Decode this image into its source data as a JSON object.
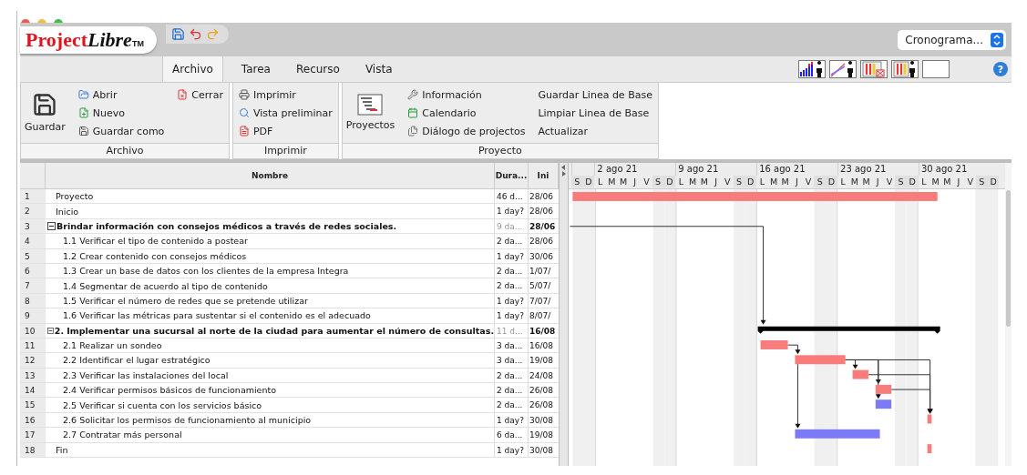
{
  "topbar": {
    "logo": {
      "brand": "Project",
      "suffix": "Libre",
      "mark": "TM"
    },
    "view_select": "Cronograma..."
  },
  "tabs": [
    {
      "label": "Archivo",
      "selected": true
    },
    {
      "label": "Tarea",
      "selected": false
    },
    {
      "label": "Recurso",
      "selected": false
    },
    {
      "label": "Vista",
      "selected": false
    }
  ],
  "help": "?",
  "ribbon": [
    {
      "label": "Archivo",
      "big": {
        "label": "Guardar",
        "kind": "save"
      },
      "columns": [
        [
          {
            "label": "Abrir",
            "kind": "open"
          },
          {
            "label": "Nuevo",
            "kind": "new"
          },
          {
            "label": "Guardar como",
            "kind": "saveas"
          }
        ],
        [
          {
            "label": "Cerrar",
            "kind": "close"
          }
        ]
      ]
    },
    {
      "label": "Imprimir",
      "columns": [
        [
          {
            "label": "Imprimir",
            "kind": "print"
          },
          {
            "label": "Vista preliminar",
            "kind": "preview"
          },
          {
            "label": "PDF",
            "kind": "pdf"
          }
        ]
      ]
    },
    {
      "label": "Proyecto",
      "big": {
        "label": "Proyectos",
        "kind": "projects"
      },
      "columns": [
        [
          {
            "label": "Información",
            "kind": "info"
          },
          {
            "label": "Calendario",
            "kind": "calendar"
          },
          {
            "label": "Diálogo de projectos",
            "kind": "dialog"
          }
        ],
        [
          {
            "label": "Guardar Linea de Base",
            "kind": "none"
          },
          {
            "label": "Limpiar Linea de Base",
            "kind": "none"
          },
          {
            "label": "Actualizar",
            "kind": "none"
          }
        ]
      ]
    }
  ],
  "table": {
    "columns": [
      "Nombre",
      "Dura...",
      "Ini"
    ],
    "rows": [
      {
        "num": "1",
        "name": "Proyecto",
        "duration": "46 d...",
        "start": "28/06",
        "bar": {
          "kind": "task",
          "color": "#f87c7c"
        }
      },
      {
        "num": "2",
        "name": "Inicio",
        "duration": "1 day?",
        "start": "28/06"
      },
      {
        "num": "3",
        "name": "Brindar información con consejos médicos a través de redes sociales.",
        "duration": "9 da...",
        "start": "28/06",
        "expanded": true,
        "children": [
          {
            "num": "4",
            "name": "1.1 Verificar el tipo de contenido a postear",
            "duration": "2 da...",
            "start": "28/06"
          },
          {
            "num": "5",
            "name": "1.2 Crear contenido con consejos médicos",
            "duration": "1 day?",
            "start": "30/06"
          },
          {
            "num": "6",
            "name": "1.3 Crear un base de datos con los clientes de la empresa Integra",
            "duration": "2 da...",
            "start": "1/07/"
          },
          {
            "num": "7",
            "name": "1.4 Segmentar de acuerdo al tipo de contenido",
            "duration": "2 da...",
            "start": "5/07/"
          },
          {
            "num": "8",
            "name": "1.5 Verificar el número de redes que se pretende utilizar",
            "duration": "1 day?",
            "start": "7/07/"
          },
          {
            "num": "9",
            "name": "1.6 Verificar las métricas para sustentar si el contenido es el adecuado",
            "duration": "1 day?",
            "start": "8/07/"
          }
        ]
      },
      {
        "num": "10",
        "name": "2. Implementar una sucursal al norte de la ciudad para aumentar el número de consultas.",
        "duration": "11 d...",
        "start": "16/08",
        "expanded": true,
        "bar": {
          "kind": "summary",
          "color": "#000000"
        },
        "children": [
          {
            "num": "11",
            "name": "2.1 Realizar un sondeo",
            "duration": "3 da...",
            "start": "16/08",
            "bar": {
              "kind": "task",
              "color": "#f87c7c"
            }
          },
          {
            "num": "12",
            "name": "2.2 Identificar el lugar estratégico",
            "duration": "3 da...",
            "start": "19/08",
            "bar": {
              "kind": "task",
              "color": "#f87c7c"
            }
          },
          {
            "num": "13",
            "name": "2.3 Verificar las instalaciones del local",
            "duration": "2 da...",
            "start": "24/08",
            "bar": {
              "kind": "task",
              "color": "#f87c7c"
            }
          },
          {
            "num": "14",
            "name": "2.4 Verificar  permisos básicos de funcionamiento",
            "duration": "2 da...",
            "start": "26/08",
            "bar": {
              "kind": "task",
              "color": "#f87c7c"
            }
          },
          {
            "num": "15",
            "name": "2.5 Verificar si cuenta con los servicios básico",
            "duration": "2 da...",
            "start": "26/08",
            "bar": {
              "kind": "task",
              "color": "#7b7bf5"
            }
          },
          {
            "num": "16",
            "name": "2.6 Solicitar los permisos de funcionamiento al municipio",
            "duration": "1 day?",
            "start": "30/08",
            "bar": {
              "kind": "task",
              "color": "#f87c7c"
            }
          },
          {
            "num": "17",
            "name": "2.7 Contratar más personal",
            "duration": "6 da...",
            "start": "19/08",
            "bar": {
              "kind": "task",
              "color": "#7b7bf5"
            }
          }
        ]
      },
      {
        "num": "18",
        "name": "Fin",
        "duration": "1 day?",
        "start": "30/08",
        "bar": {
          "kind": "task",
          "color": "#f87c7c"
        }
      }
    ]
  },
  "gantt": {
    "weeks": [
      "2 ago 21",
      "9 ago 21",
      "16 ago 21",
      "23 ago 21",
      "30 ago 21"
    ],
    "days": [
      {
        "letter": "S",
        "weekend": true
      },
      {
        "letter": "D",
        "weekend": true
      },
      {
        "letter": "L",
        "weekend": false
      },
      {
        "letter": "M",
        "weekend": false
      },
      {
        "letter": "M",
        "weekend": false
      },
      {
        "letter": "J",
        "weekend": false
      },
      {
        "letter": "V",
        "weekend": false
      },
      {
        "letter": "S",
        "weekend": true
      },
      {
        "letter": "D",
        "weekend": true
      },
      {
        "letter": "L",
        "weekend": false
      },
      {
        "letter": "M",
        "weekend": false
      },
      {
        "letter": "M",
        "weekend": false
      },
      {
        "letter": "J",
        "weekend": false
      },
      {
        "letter": "V",
        "weekend": false
      },
      {
        "letter": "S",
        "weekend": true
      },
      {
        "letter": "D",
        "weekend": true
      },
      {
        "letter": "L",
        "weekend": false
      },
      {
        "letter": "M",
        "weekend": false
      },
      {
        "letter": "M",
        "weekend": false
      },
      {
        "letter": "J",
        "weekend": false
      },
      {
        "letter": "V",
        "weekend": false
      },
      {
        "letter": "S",
        "weekend": true
      },
      {
        "letter": "D",
        "weekend": true
      },
      {
        "letter": "L",
        "weekend": false
      },
      {
        "letter": "M",
        "weekend": false
      },
      {
        "letter": "M",
        "weekend": false
      },
      {
        "letter": "J",
        "weekend": false
      },
      {
        "letter": "V",
        "weekend": false
      },
      {
        "letter": "S",
        "weekend": true
      },
      {
        "letter": "D",
        "weekend": true
      },
      {
        "letter": "L",
        "weekend": false
      },
      {
        "letter": "M",
        "weekend": false
      },
      {
        "letter": "M",
        "weekend": false
      },
      {
        "letter": "J",
        "weekend": false
      },
      {
        "letter": "V",
        "weekend": false
      },
      {
        "letter": "S",
        "weekend": true
      },
      {
        "letter": "D",
        "weekend": true
      }
    ]
  }
}
